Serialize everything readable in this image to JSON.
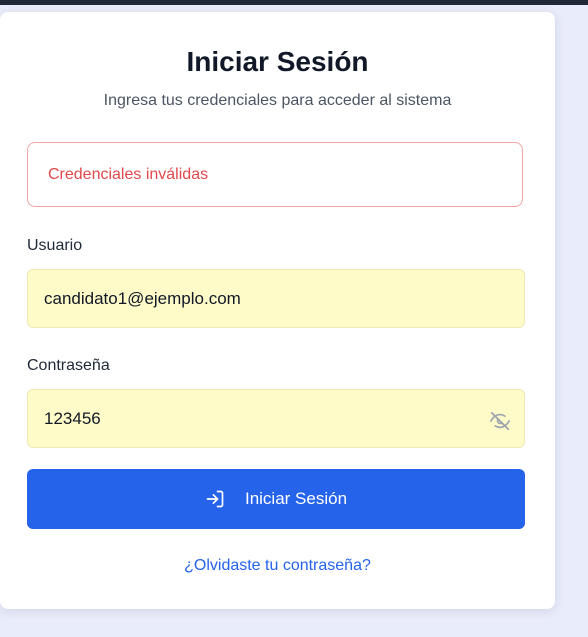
{
  "login": {
    "title": "Iniciar Sesión",
    "subtitle": "Ingresa tus credenciales para acceder al sistema",
    "error_message": "Credenciales inválidas",
    "username": {
      "label": "Usuario",
      "value": "candidato1@ejemplo.com"
    },
    "password": {
      "label": "Contraseña",
      "value": "123456",
      "toggle_icon": "eye-off-icon"
    },
    "submit_label": "Iniciar Sesión",
    "submit_icon": "login-icon",
    "forgot_password_label": "¿Olvidaste tu contraseña?"
  },
  "colors": {
    "accent": "#2563eb",
    "error": "#e0484b",
    "autofill_background": "#fefbc8",
    "page_background": "#e9ecfa"
  }
}
